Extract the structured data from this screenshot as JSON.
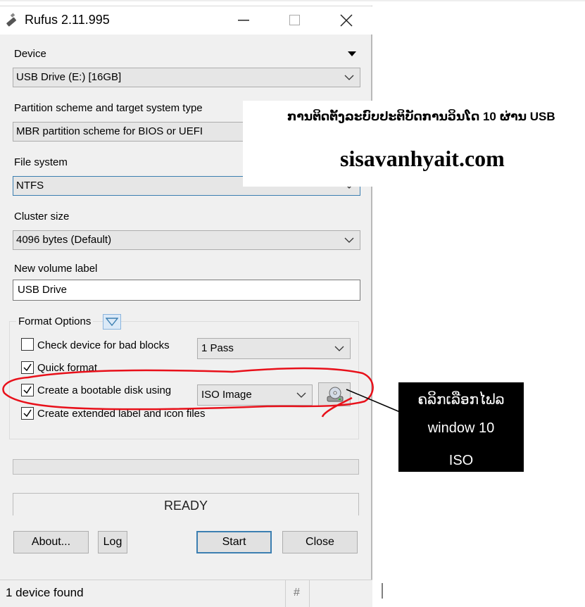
{
  "window": {
    "title": "Rufus 2.11.995",
    "minimize_glyph": "—",
    "maximize_glyph": "☐",
    "close_glyph": "✕"
  },
  "device": {
    "label": "Device",
    "value": "USB Drive (E:) [16GB]"
  },
  "partition": {
    "label": "Partition scheme and target system type",
    "value": "MBR partition scheme for BIOS or UEFI"
  },
  "filesystem": {
    "label": "File system",
    "value": "NTFS"
  },
  "cluster": {
    "label": "Cluster size",
    "value": "4096 bytes (Default)"
  },
  "volume": {
    "label": "New volume label",
    "value": "USB Drive"
  },
  "format_options": {
    "label": "Format Options",
    "bad_blocks": {
      "label": "Check device for bad blocks",
      "checked": false,
      "passes": "1 Pass"
    },
    "quick_format": {
      "label": "Quick format",
      "checked": true
    },
    "bootable": {
      "label": "Create a bootable disk using",
      "checked": true,
      "type": "ISO Image"
    },
    "extended_label": {
      "label": "Create extended label and icon files",
      "checked": true
    }
  },
  "status": "READY",
  "buttons": {
    "about": "About...",
    "log": "Log",
    "start": "Start",
    "close": "Close"
  },
  "statusbar": {
    "text": "1 device found",
    "hash": "#"
  },
  "overlay": {
    "title": "ການຕິດຕັ້ງລະບົບປະຕິບັດການວິນໂດ 10 ຜ່ານ USB",
    "site": "sisavanhyait.com"
  },
  "callout": {
    "line1": "ຄລິກເລືອກໄຟລ",
    "line2": "window 10",
    "line3": "ISO"
  },
  "colors": {
    "annotation_red": "#e8101a",
    "accent_blue": "#3c7fb1"
  }
}
